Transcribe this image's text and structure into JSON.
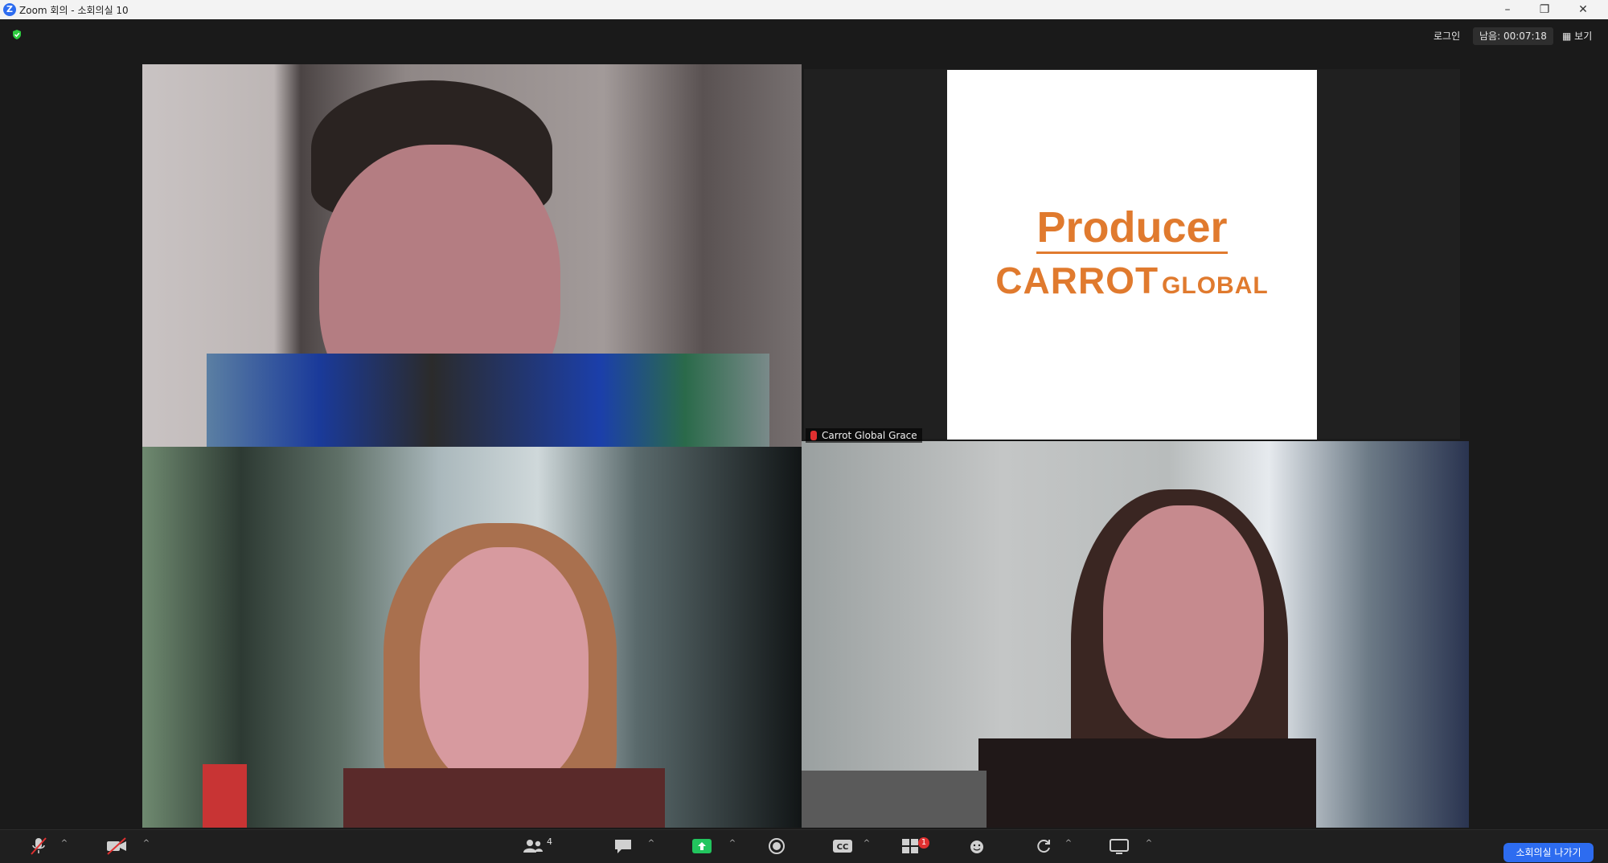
{
  "window": {
    "title": "Zoom 회의 - 소회의실 10",
    "minimize": "–",
    "restore": "❐",
    "close": "✕"
  },
  "header": {
    "left_label": "로그인",
    "timer": "남음: 00:07:18",
    "view_label": "▦ 보기"
  },
  "slide": {
    "title": "Producer",
    "brand_big": "CARROT",
    "brand_small": "GLOBAL"
  },
  "participants": [
    {
      "name": "Carrot Global Grace"
    }
  ],
  "toolbar": {
    "participants_count": "4",
    "share_badge": "1",
    "leave_label": "소회의실 나가기"
  },
  "colors": {
    "accent": "#2d6cf0",
    "brand_orange": "#e07a2e",
    "share_green": "#22c55e",
    "badge_red": "#e03030"
  }
}
